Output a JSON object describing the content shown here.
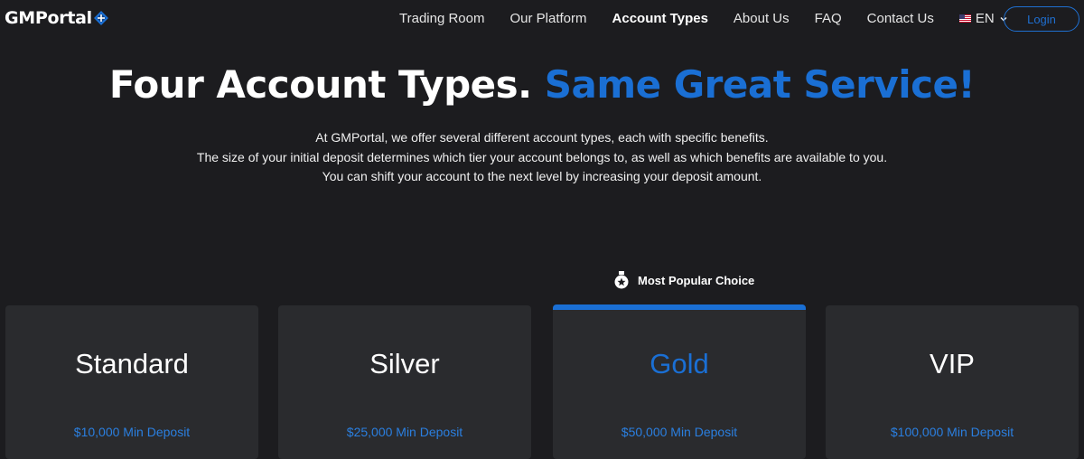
{
  "brand": {
    "name": "GMPortal",
    "logo_icon": "diamond-cross-icon",
    "accent_color": "#1a6fd4"
  },
  "nav": {
    "items": [
      {
        "label": "Trading Room"
      },
      {
        "label": "Our Platform"
      },
      {
        "label": "Account Types",
        "active": true
      },
      {
        "label": "About Us"
      },
      {
        "label": "FAQ"
      },
      {
        "label": "Contact Us"
      }
    ],
    "language": {
      "label": "EN",
      "icon": "us-flag-icon"
    },
    "login_label": "Login"
  },
  "hero": {
    "title_white": "Four Account Types.",
    "title_blue": "Same Great Service!",
    "description": [
      "At GMPortal, we offer several different account types, each with specific benefits.",
      "The size of your initial deposit determines which tier your account belongs to, as well as which benefits are available to you.",
      "You can shift your account to the next level by increasing your deposit amount."
    ]
  },
  "popular": {
    "label": "Most Popular Choice",
    "icon": "medal-icon"
  },
  "accounts": [
    {
      "name": "Standard",
      "deposit": "$10,000 Min Deposit"
    },
    {
      "name": "Silver",
      "deposit": "$25,000 Min Deposit"
    },
    {
      "name": "Gold",
      "deposit": "$50,000 Min Deposit",
      "highlighted": true
    },
    {
      "name": "VIP",
      "deposit": "$100,000 Min Deposit"
    }
  ]
}
